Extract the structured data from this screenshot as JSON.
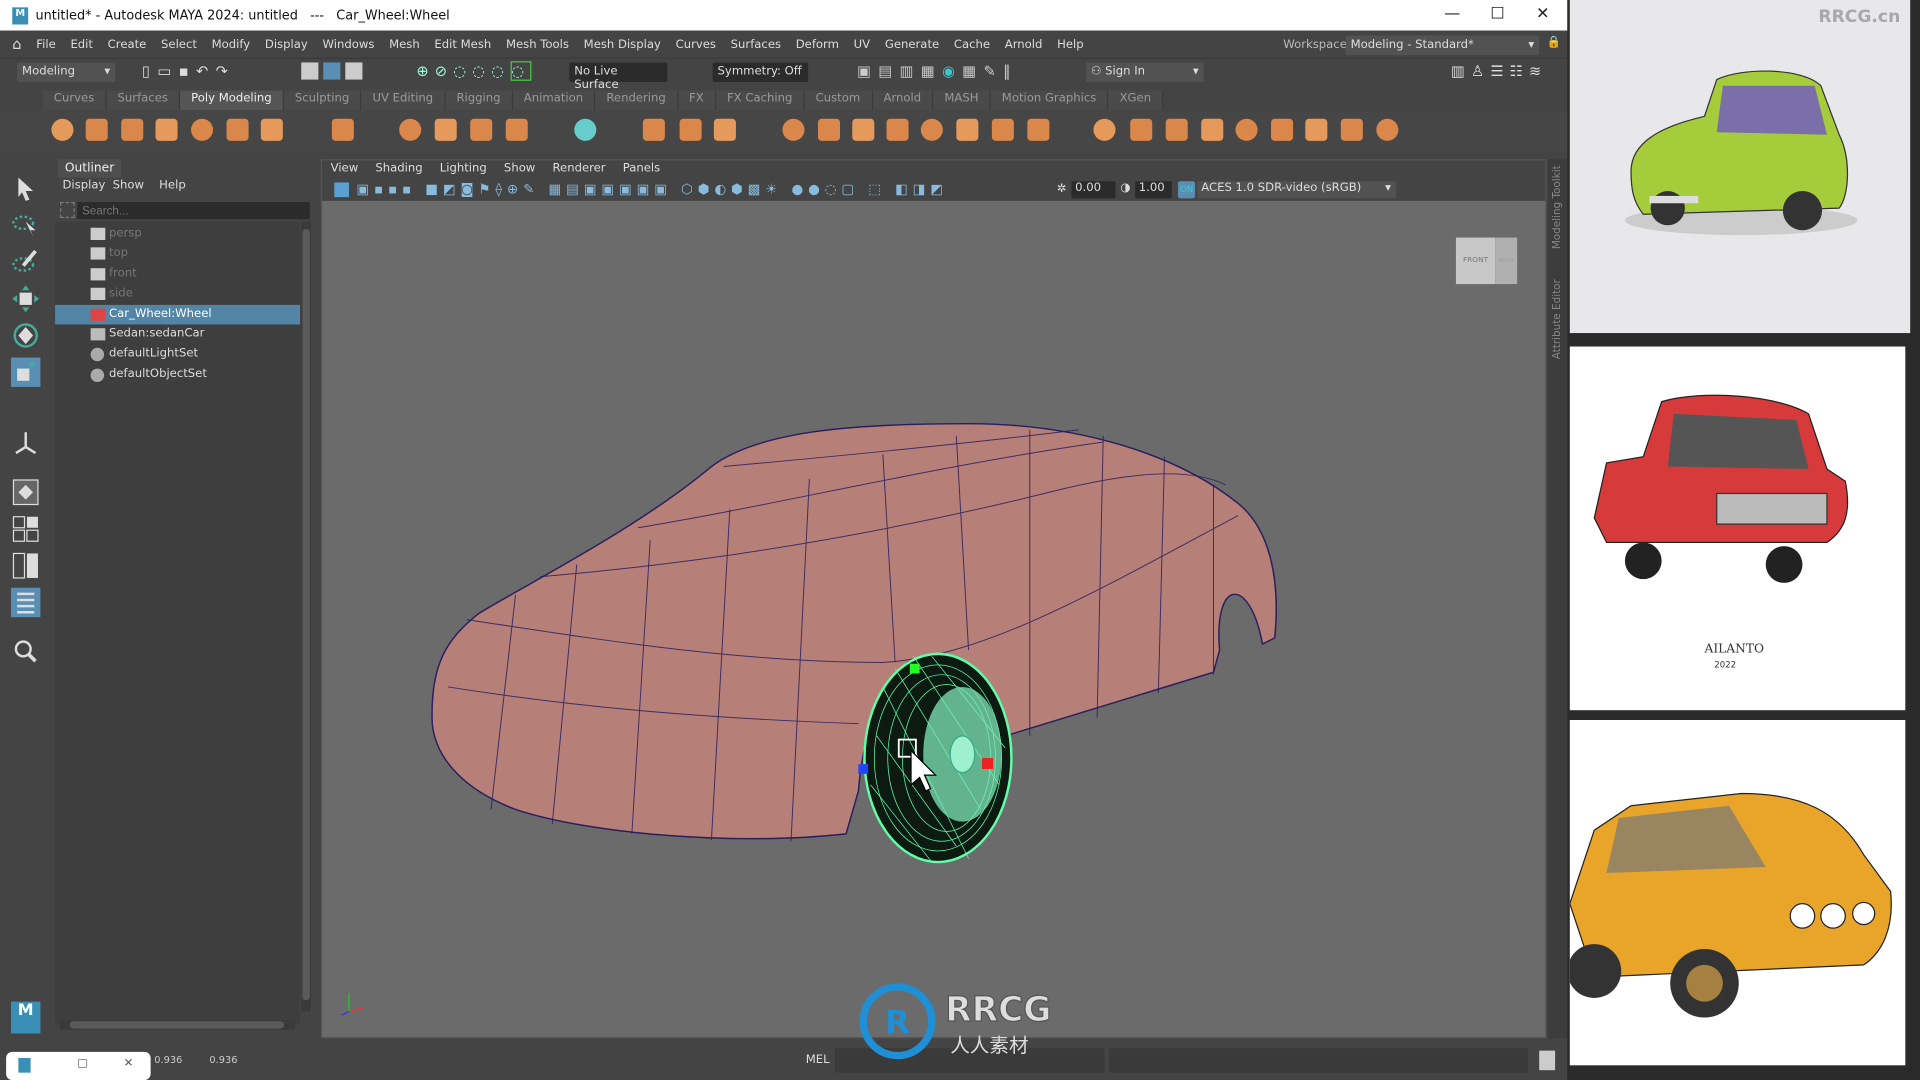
{
  "window": {
    "title": "untitled* - Autodesk MAYA 2024: untitled   ---   Car_Wheel:Wheel",
    "logo": "M",
    "minimize": "—",
    "maximize": "☐",
    "close": "✕"
  },
  "menubar": [
    "File",
    "Edit",
    "Create",
    "Select",
    "Modify",
    "Display",
    "Windows",
    "Mesh",
    "Edit Mesh",
    "Mesh Tools",
    "Mesh Display",
    "Curves",
    "Surfaces",
    "Deform",
    "UV",
    "Generate",
    "Cache",
    "Arnold",
    "Help"
  ],
  "workspace": {
    "label": "Workspace:",
    "value": "Modeling - Standard*"
  },
  "statusline": {
    "mode": "Modeling",
    "live_surface": "No Live Surface",
    "symmetry": "Symmetry: Off",
    "sign_in": "Sign In"
  },
  "shelf_tabs": [
    "Curves",
    "Surfaces",
    "Poly Modeling",
    "Sculpting",
    "UV Editing",
    "Rigging",
    "Animation",
    "Rendering",
    "FX",
    "FX Caching",
    "Custom",
    "Arnold",
    "MASH",
    "Motion Graphics",
    "XGen"
  ],
  "shelf_active": "Poly Modeling",
  "shelf_icons": [
    "sphere-icon",
    "cube-icon",
    "cylinder-icon",
    "cone-icon",
    "torus-icon",
    "plane-icon",
    "disc-icon",
    "platonic-icon",
    "super-shape-icon",
    "sweep-icon",
    "type-icon",
    "svg-icon",
    "grid-icon",
    "measure-icon",
    "transform-icon",
    "combine-icon",
    "separate-icon",
    "smooth-icon",
    "boolean-icon",
    "mirror-icon",
    "bevel-icon",
    "bridge-icon",
    "extrude-icon",
    "append-icon",
    "fill-hole-icon",
    "merge-icon",
    "wedge-icon",
    "poke-icon",
    "chamfer-icon",
    "collapse-icon",
    "multi-cut-icon",
    "edge-loop-icon",
    "target-weld-icon"
  ],
  "outliner": {
    "tab": "Outliner",
    "menu": [
      "Display",
      "Show",
      "Help"
    ],
    "search_placeholder": "Search...",
    "items": [
      {
        "label": "persp",
        "type": "camera"
      },
      {
        "label": "top",
        "type": "camera"
      },
      {
        "label": "front",
        "type": "camera"
      },
      {
        "label": "side",
        "type": "camera"
      },
      {
        "label": "Car_Wheel:Wheel",
        "type": "mesh",
        "selected": true
      },
      {
        "label": "Sedan:sedanCar",
        "type": "group"
      },
      {
        "label": "defaultLightSet",
        "type": "set"
      },
      {
        "label": "defaultObjectSet",
        "type": "set"
      }
    ]
  },
  "viewport": {
    "menu": [
      "View",
      "Shading",
      "Lighting",
      "Show",
      "Renderer",
      "Panels"
    ],
    "exposure": "0.00",
    "gamma": "1.00",
    "color_space": "ACES 1.0 SDR-video (sRGB)",
    "viewcube_front": "FRONT",
    "viewcube_right": "RIGHT"
  },
  "side_tabs": {
    "modeling_toolkit": "Modeling Toolkit",
    "attribute_editor": "Attribute Editor"
  },
  "bottom": {
    "val1": "0.936",
    "val2": "0.936",
    "mel": "MEL"
  },
  "watermark": {
    "text": "RRCG",
    "sub": "人人素材",
    "corner": "RRCG.cn"
  },
  "reference": {
    "signature": "AILANTO",
    "year": "2022"
  },
  "colors": {
    "selection": "#5285a6",
    "mesh": "#b67f78",
    "wire_selected": "#5fffa8",
    "viewport_bg": "#6b6b6b"
  }
}
